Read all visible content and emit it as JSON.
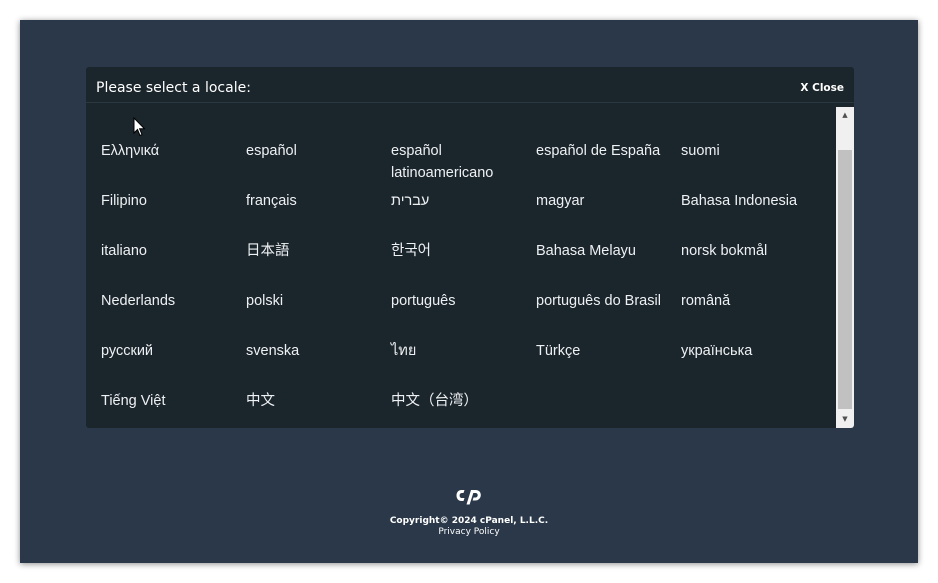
{
  "modal": {
    "title": "Please select a locale:",
    "close_label": "X Close"
  },
  "locales": [
    "Ελληνικά",
    "español",
    "español latinoamericano",
    "español de España",
    "suomi",
    "Filipino",
    "français",
    "עברית",
    "magyar",
    "Bahasa Indonesia",
    "italiano",
    "日本語",
    "한국어",
    "Bahasa Melayu",
    "norsk bokmål",
    "Nederlands",
    "polski",
    "português",
    "português do Brasil",
    "română",
    "русский",
    "svenska",
    "ไทย",
    "Türkçe",
    "українська",
    "Tiếng Việt",
    "中文",
    "中文（台湾）"
  ],
  "footer": {
    "copyright": "Copyright© 2024 cPanel, L.L.C.",
    "privacy": "Privacy Policy"
  },
  "icons": {
    "logo": "cpanel-logo-icon",
    "scroll_up": "scroll-up-arrow-icon",
    "scroll_down": "scroll-down-arrow-icon",
    "cursor": "mouse-pointer-icon"
  },
  "colors": {
    "page_background": "#2a3849",
    "modal_background": "#1b252c",
    "text": "#eef1f3"
  }
}
